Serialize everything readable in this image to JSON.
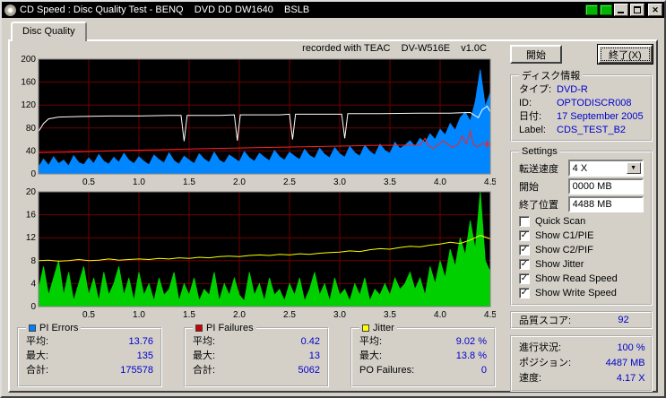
{
  "window": {
    "title": "CD Speed : Disc Quality Test - BENQ    DVD DD DW1640    BSLB"
  },
  "tabs": [
    {
      "label": "Disc Quality"
    }
  ],
  "header": {
    "recorded_with": "recorded with TEAC    DV-W516E    v1.0C"
  },
  "actions": {
    "start": "開始",
    "exit": "終了(X)"
  },
  "disc_info": {
    "title": "ディスク情報",
    "rows": [
      {
        "label": "タイプ:",
        "value": "DVD-R"
      },
      {
        "label": "ID:",
        "value": "OPTODISCR008"
      },
      {
        "label": "日付:",
        "value": "17 September 2005"
      },
      {
        "label": "Label:",
        "value": "CDS_TEST_B2"
      }
    ]
  },
  "settings": {
    "title": "Settings",
    "speed_label": "転送速度",
    "speed_value": "4 X",
    "start_label": "開始",
    "start_value": "0000 MB",
    "end_label": "終了位置",
    "end_value": "4488 MB",
    "checkboxes": [
      {
        "label": "Quick Scan",
        "checked": false
      },
      {
        "label": "Show C1/PIE",
        "checked": true
      },
      {
        "label": "Show C2/PIF",
        "checked": true
      },
      {
        "label": "Show Jitter",
        "checked": true
      },
      {
        "label": "Show Read Speed",
        "checked": true
      },
      {
        "label": "Show Write Speed",
        "checked": true
      }
    ]
  },
  "quality": {
    "label": "品質スコア:",
    "value": "92"
  },
  "progress": {
    "rows": [
      {
        "label": "進行状況:",
        "value": "100 %"
      },
      {
        "label": "ポジション:",
        "value": "4487 MB"
      },
      {
        "label": "速度:",
        "value": "4.17 X"
      }
    ]
  },
  "stats": [
    {
      "title": "PI Errors",
      "color": "#0080ff",
      "rows": [
        {
          "label": "平均:",
          "value": "13.76"
        },
        {
          "label": "最大:",
          "value": "135"
        },
        {
          "label": "合計:",
          "value": "175578"
        }
      ]
    },
    {
      "title": "PI Failures",
      "color": "#cc0000",
      "rows": [
        {
          "label": "平均:",
          "value": "0.42"
        },
        {
          "label": "最大:",
          "value": "13"
        },
        {
          "label": "合計:",
          "value": "5062"
        }
      ]
    },
    {
      "title": "Jitter",
      "color": "#ffff00",
      "rows": [
        {
          "label": "平均:",
          "value": "9.02 %"
        },
        {
          "label": "最大:",
          "value": "13.8 %"
        },
        {
          "label": "PO Failures:",
          "value": "0"
        }
      ]
    }
  ],
  "chart_data": [
    {
      "type": "area",
      "title": "PI Errors / Read & Write Speed",
      "xlim": [
        0,
        4.5
      ],
      "ylim": [
        0,
        200
      ],
      "x_ticks": [
        0.5,
        1.0,
        1.5,
        2.0,
        2.5,
        3.0,
        3.5,
        4.0,
        4.5
      ],
      "y_ticks": [
        0,
        40,
        80,
        120,
        160,
        200
      ],
      "grid": true,
      "series": [
        {
          "name": "PI Errors",
          "type": "area",
          "color": "#0086ff",
          "x_step": 0.05,
          "values": [
            12,
            26,
            15,
            30,
            18,
            24,
            14,
            32,
            20,
            16,
            28,
            18,
            34,
            22,
            17,
            29,
            20,
            36,
            24,
            18,
            30,
            22,
            16,
            33,
            25,
            19,
            37,
            23,
            17,
            31,
            24,
            18,
            35,
            26,
            20,
            38,
            24,
            19,
            33,
            27,
            21,
            39,
            28,
            22,
            36,
            29,
            23,
            41,
            30,
            24,
            38,
            31,
            25,
            43,
            32,
            27,
            45,
            34,
            28,
            46,
            35,
            29,
            48,
            37,
            31,
            50,
            39,
            33,
            52,
            41,
            36,
            55,
            44,
            50,
            58,
            48,
            62,
            55,
            70,
            60,
            78,
            68,
            88,
            76,
            98,
            108,
            92,
            126,
            182,
            118,
            142
          ]
        },
        {
          "name": "Read Speed",
          "type": "line",
          "color": "#ffffff",
          "points": [
            [
              0,
              74
            ],
            [
              0.05,
              88
            ],
            [
              0.1,
              96
            ],
            [
              0.2,
              99
            ],
            [
              0.4,
              100
            ],
            [
              0.7,
              101
            ],
            [
              1.0,
              101
            ],
            [
              1.3,
              102
            ],
            [
              1.42,
              102
            ],
            [
              1.45,
              57
            ],
            [
              1.48,
              102
            ],
            [
              1.8,
              102
            ],
            [
              1.95,
              103
            ],
            [
              1.98,
              58
            ],
            [
              2.01,
              103
            ],
            [
              2.4,
              103
            ],
            [
              2.5,
              104
            ],
            [
              2.53,
              60
            ],
            [
              2.56,
              104
            ],
            [
              2.9,
              104
            ],
            [
              3.02,
              104
            ],
            [
              3.05,
              62
            ],
            [
              3.08,
              105
            ],
            [
              3.4,
              105
            ],
            [
              3.8,
              106
            ],
            [
              4.1,
              106
            ],
            [
              4.3,
              107
            ],
            [
              4.38,
              98
            ],
            [
              4.42,
              112
            ],
            [
              4.47,
              118
            ],
            [
              4.5,
              108
            ]
          ]
        },
        {
          "name": "Write Speed",
          "type": "line",
          "color": "#ff2020",
          "end_marker": "cross",
          "points": [
            [
              0,
              37
            ],
            [
              0.3,
              38
            ],
            [
              0.6,
              39.5
            ],
            [
              0.9,
              41
            ],
            [
              1.2,
              42
            ],
            [
              1.5,
              43.5
            ],
            [
              1.8,
              44.5
            ],
            [
              2.1,
              45.5
            ],
            [
              2.4,
              46.5
            ],
            [
              2.7,
              47.5
            ],
            [
              3.0,
              48.5
            ],
            [
              3.3,
              49.5
            ],
            [
              3.6,
              50
            ],
            [
              3.8,
              50.5
            ],
            [
              3.85,
              62
            ],
            [
              3.88,
              50
            ],
            [
              3.93,
              44
            ],
            [
              3.98,
              51
            ],
            [
              4.03,
              58
            ],
            [
              4.08,
              51
            ],
            [
              4.13,
              46
            ],
            [
              4.18,
              52
            ],
            [
              4.22,
              66
            ],
            [
              4.26,
              52
            ],
            [
              4.3,
              75
            ],
            [
              4.33,
              52
            ],
            [
              4.37,
              47
            ],
            [
              4.42,
              53
            ],
            [
              4.47,
              52
            ]
          ]
        }
      ]
    },
    {
      "type": "area",
      "title": "PI Failures / Jitter",
      "xlim": [
        0,
        4.5
      ],
      "ylim": [
        0,
        20
      ],
      "x_ticks": [
        0.5,
        1.0,
        1.5,
        2.0,
        2.5,
        3.0,
        3.5,
        4.0,
        4.5
      ],
      "y_ticks": [
        0,
        4,
        8,
        12,
        16,
        20
      ],
      "grid": true,
      "series": [
        {
          "name": "PI Failures",
          "type": "area",
          "color": "#00d000",
          "x_step": 0.05,
          "values": [
            3,
            7,
            2,
            5,
            8,
            2,
            6,
            1,
            4,
            7,
            2,
            5,
            1,
            6,
            2,
            4,
            7,
            2,
            5,
            1,
            6,
            2,
            4,
            1,
            5,
            2,
            3,
            6,
            1,
            4,
            2,
            5,
            1,
            3,
            2,
            6,
            1,
            4,
            2,
            5,
            2,
            1,
            6,
            2,
            4,
            1,
            5,
            2,
            3,
            1,
            4,
            2,
            5,
            1,
            3,
            6,
            2,
            4,
            1,
            5,
            2,
            3,
            1,
            4,
            2,
            5,
            1,
            3,
            2,
            4,
            2,
            5,
            3,
            4,
            6,
            3,
            5,
            2,
            7,
            4,
            8,
            5,
            10,
            7,
            12,
            9,
            15,
            10,
            20,
            8,
            6
          ]
        },
        {
          "name": "Jitter",
          "type": "line",
          "color": "#ffff00",
          "x_step": 0.1,
          "values": [
            8.0,
            8.1,
            7.9,
            8.0,
            8.2,
            8.0,
            8.1,
            8.3,
            8.1,
            8.2,
            8.3,
            8.2,
            8.4,
            8.3,
            8.5,
            8.4,
            8.6,
            8.5,
            8.7,
            8.8,
            8.7,
            8.9,
            9.0,
            8.9,
            9.1,
            9.0,
            9.2,
            9.1,
            9.3,
            9.4,
            9.5,
            9.7,
            9.6,
            9.9,
            10.1,
            10.0,
            10.3,
            10.5,
            10.4,
            10.7,
            10.9,
            11.2,
            11.0,
            11.6,
            12.4,
            11.8
          ]
        }
      ]
    }
  ]
}
